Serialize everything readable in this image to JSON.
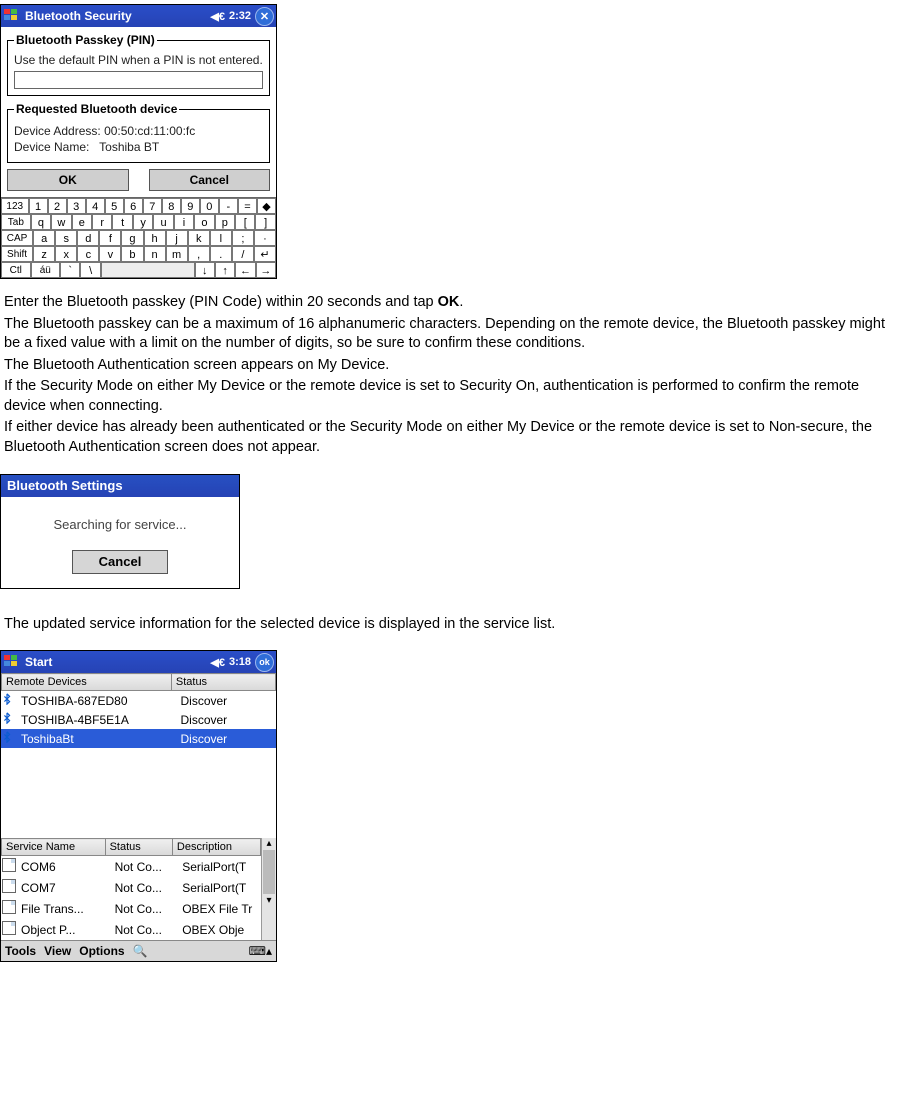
{
  "screenshot1": {
    "titlebar": {
      "title": "Bluetooth Security",
      "time": "2:32",
      "close_glyph": "✕"
    },
    "passkey_group": {
      "legend": "Bluetooth Passkey (PIN)",
      "hint": "Use the default PIN when a PIN is not entered.",
      "input_value": ""
    },
    "device_group": {
      "legend": "Requested Bluetooth device",
      "addr_label": "Device Address:",
      "addr_value": "00:50:cd:11:00:fc",
      "name_label": "Device Name:",
      "name_value": "Toshiba BT"
    },
    "buttons": {
      "ok": "OK",
      "cancel": "Cancel"
    },
    "keyboard": {
      "row1": [
        "123",
        "1",
        "2",
        "3",
        "4",
        "5",
        "6",
        "7",
        "8",
        "9",
        "0",
        "-",
        "=",
        "◆"
      ],
      "row2": [
        "Tab",
        "q",
        "w",
        "e",
        "r",
        "t",
        "y",
        "u",
        "i",
        "o",
        "p",
        "[",
        "]"
      ],
      "row3": [
        "CAP",
        "a",
        "s",
        "d",
        "f",
        "g",
        "h",
        "j",
        "k",
        "l",
        ";",
        "·"
      ],
      "row4": [
        "Shift",
        "z",
        "x",
        "c",
        "v",
        "b",
        "n",
        "m",
        ",",
        ".",
        "/",
        "↵"
      ],
      "row5": [
        "Ctl",
        "áü",
        "`",
        "\\",
        " ",
        "↓",
        "↑",
        "←",
        "→"
      ]
    }
  },
  "paragraphs": {
    "p1a": "Enter the Bluetooth passkey (PIN Code) within 20 seconds and tap ",
    "p1b": "OK",
    "p1c": ".",
    "p2": "The Bluetooth passkey can be a maximum of 16 alphanumeric characters. Depending on the remote device, the Bluetooth passkey might be a fixed value with a limit on the number of digits, so be sure to confirm these conditions.",
    "p3": "The Bluetooth Authentication screen appears on My Device.",
    "p4": "If the Security Mode on either My Device or the remote device is set to Security On, authentication is performed to confirm the remote device when connecting.",
    "p5": "If either device has already been authenticated or the Security Mode on either My Device or the remote device is set to Non-secure, the Bluetooth Authentication screen does not appear.",
    "p6": "The updated service information for the selected device is displayed in the service list."
  },
  "screenshot2": {
    "title": "Bluetooth Settings",
    "status": "Searching for service...",
    "cancel": "Cancel"
  },
  "screenshot3": {
    "titlebar": {
      "title": "Start",
      "time": "3:18",
      "ok_glyph": "ok"
    },
    "cols": {
      "c1": "Remote Devices",
      "c2": "Status"
    },
    "devices": [
      {
        "name": "TOSHIBA-687ED80",
        "status": "Discover"
      },
      {
        "name": "TOSHIBA-4BF5E1A",
        "status": "Discover"
      },
      {
        "name": "ToshibaBt",
        "status": "Discover",
        "selected": true
      }
    ],
    "svc_cols": {
      "c1": "Service Name",
      "c2": "Status",
      "c3": "Description"
    },
    "services": [
      {
        "name": "COM6",
        "status": "Not Co...",
        "desc": "SerialPort(T"
      },
      {
        "name": "COM7",
        "status": "Not Co...",
        "desc": "SerialPort(T"
      },
      {
        "name": "File Trans...",
        "status": "Not Co...",
        "desc": "OBEX File Tr"
      },
      {
        "name": "Object P...",
        "status": "Not Co...",
        "desc": "OBEX Obje"
      }
    ],
    "menubar": {
      "tools": "Tools",
      "view": "View",
      "options": "Options"
    },
    "sip_glyph": "⌨▴"
  }
}
